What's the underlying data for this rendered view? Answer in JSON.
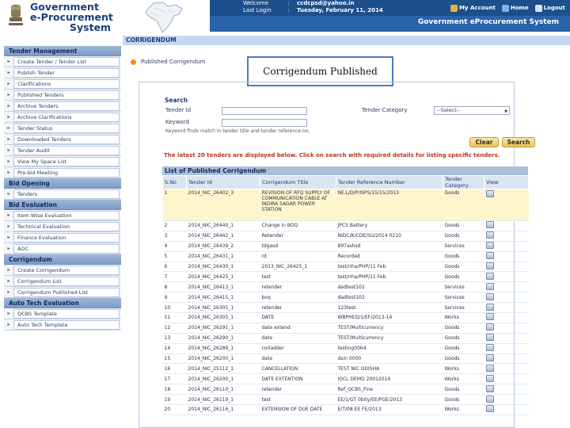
{
  "header": {
    "logo_lines": [
      "Government",
      "e-Procurement",
      "System"
    ],
    "welcome_label": "Welcome",
    "welcome_value": "ccdcpsd@yahoo.in",
    "lastlogin_label": "Last Login",
    "lastlogin_value": "Tuesday, February 11, 2014",
    "colon": ":",
    "my_account": "My Account",
    "home": "Home",
    "logout": "Logout",
    "system_title": "Government eProcurement System",
    "colors": {
      "bar_dark": "#1d4f8c",
      "bar_light": "#2a64a8"
    }
  },
  "sidebar": {
    "sections": [
      {
        "title": "Tender Management",
        "items": [
          "Create Tender / Tender List",
          "Publish Tender",
          "Clarifications",
          "Published Tenders",
          "Archive Tenders",
          "Archive Clarifications",
          "Tender Status",
          "Downloaded Tenders",
          "Tender Audit",
          "View My Space List",
          "Pre-bid Meeting"
        ]
      },
      {
        "title": "Bid Opening",
        "items": [
          "Tenders"
        ]
      },
      {
        "title": "Bid Evaluation",
        "items": [
          "Item Wise Evaluation",
          "Technical Evaluation",
          "Finance Evaluation",
          "AOC"
        ]
      },
      {
        "title": "Corrigendum",
        "items": [
          "Create Corrigendum",
          "Corrigendum List",
          "Corrigendum Published List"
        ]
      },
      {
        "title": "Auto Tech Evaluation",
        "items": [
          "QCBS Template",
          "Auto Tech Template"
        ]
      }
    ]
  },
  "main": {
    "tab": "CORRIGENDUM",
    "page_title": "Published Corrigendum",
    "callout": "Corrigendum Published",
    "search": {
      "heading": "Search",
      "tender_id_label": "Tender Id",
      "keyword_label": "Keyword",
      "keyword_hint": "Keyword finds match in tender title and tender reference no.",
      "category_label": "Tender Category",
      "category_value": "--Select--",
      "clear_button": "Clear",
      "search_button": "Search"
    },
    "note": "The latest 20 tenders are displayed below. Click on search with required details for listing specific tenders.",
    "table": {
      "caption": "List of Published Corrigendum",
      "columns": [
        "S.No",
        "Tender Id",
        "Corrigendum Title",
        "Tender Reference Number",
        "Tender Category",
        "View"
      ],
      "rows": [
        [
          "1",
          "2014_NIC_26402_3",
          "REVISION OF RFQ SUPPLY OF COMMUNICATION CABLE AT INDIRA SAGAR POWER STATION",
          "NE.L/D/P/ISPS/15/15/2013",
          "Goods"
        ],
        [
          "2",
          "2014_NIC_26440_1",
          "Change in BOQ",
          "JPCS Battery",
          "Goods"
        ],
        [
          "3",
          "2014_NIC_26442_1",
          "Retender",
          "NIDC/K/CDE/SU/2014 0210",
          "Goods"
        ],
        [
          "4",
          "2014_NIC_26439_2",
          "tdgasd",
          "897ashsd",
          "Services"
        ],
        [
          "5",
          "2014_NIC_26431_1",
          "rd",
          "Recorded",
          "Goods"
        ],
        [
          "6",
          "2014_NIC_26430_1",
          "2013_NIC_26425_1",
          "test/nha/PHP/11 Feb",
          "Goods"
        ],
        [
          "7",
          "2014_NIC_26425_1",
          "test",
          "test/nha/PHP/11 Feb",
          "Goods"
        ],
        [
          "8",
          "2014_NIC_26413_1",
          "retender",
          "dadtest102",
          "Services"
        ],
        [
          "9",
          "2014_NIC_26415_1",
          "boq",
          "dadtest102",
          "Services"
        ],
        [
          "10",
          "2014_NIC_26305_1",
          "retender",
          "123test",
          "Services"
        ],
        [
          "11",
          "2014_NIC_26305_1",
          "DATE",
          "WBPHED/1/EF/2013-14",
          "Works"
        ],
        [
          "12",
          "2014_NIC_26291_1",
          "date extend",
          "TEST/Multicurrency",
          "Goods"
        ],
        [
          "13",
          "2014_NIC_26290_1",
          "date",
          "TEST/Multicurrency",
          "Goods"
        ],
        [
          "14",
          "2014_NIC_26289_1",
          "corladder",
          "testing0064",
          "Goods"
        ],
        [
          "15",
          "2014_NIC_26200_1",
          "date",
          "dsin 0000",
          "Goods"
        ],
        [
          "16",
          "2014_NIC_25112_1",
          "CANCELLATION",
          "TEST NIC ODISHA",
          "Works"
        ],
        [
          "17",
          "2014_NIC_26200_1",
          "DATE EXTENTION",
          "IOCL DEMO 20012014",
          "Works"
        ],
        [
          "18",
          "2014_NIC_26110_1",
          "retender",
          "Ref_QCBS_Fine",
          "Goods"
        ],
        [
          "19",
          "2014_NIC_26119_1",
          "test",
          "EE/1/GT 0bity/EE/PGE/2013",
          "Goods"
        ],
        [
          "20",
          "2014_NIC_26116_1",
          "EXTENSION OF DUE DATE",
          "E/T/08 EE FE/2013",
          "Works"
        ]
      ]
    }
  }
}
